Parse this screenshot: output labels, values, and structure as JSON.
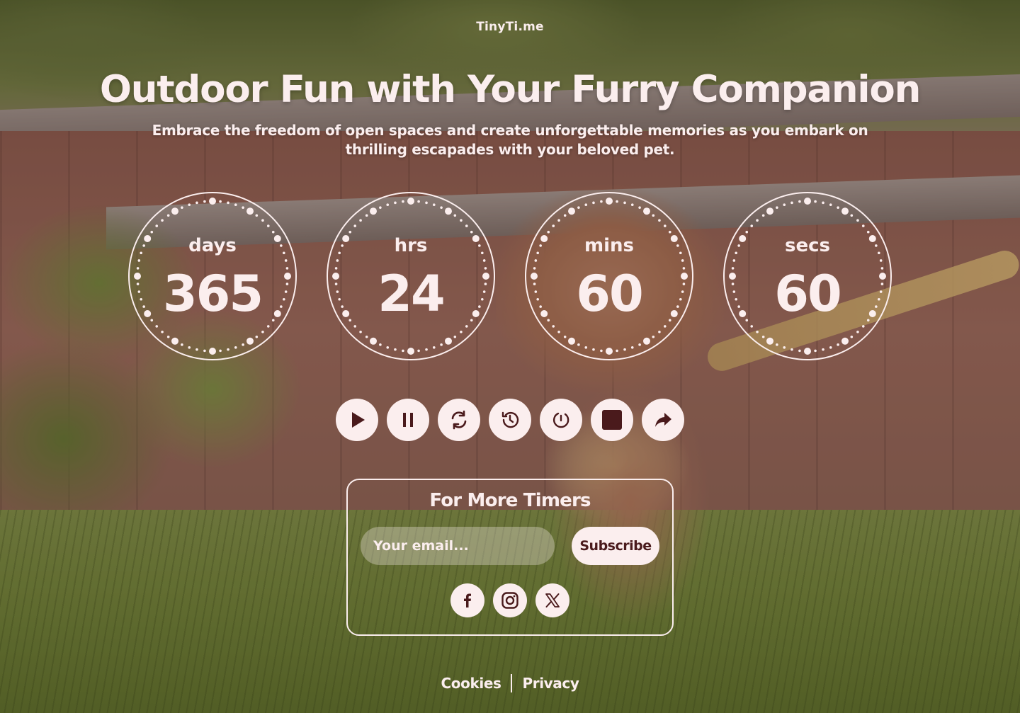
{
  "brand": "TinyTi.me",
  "hero": {
    "title": "Outdoor Fun with Your Furry Companion",
    "subtitle": "Embrace the freedom of open spaces and create unforgettable memories as you embark on thrilling escapades with your beloved pet."
  },
  "timer": [
    {
      "label": "days",
      "value": "365"
    },
    {
      "label": "hrs",
      "value": "24"
    },
    {
      "label": "mins",
      "value": "60"
    },
    {
      "label": "secs",
      "value": "60"
    }
  ],
  "controls": [
    {
      "name": "play",
      "icon": "play-icon"
    },
    {
      "name": "pause",
      "icon": "pause-icon"
    },
    {
      "name": "restart",
      "icon": "refresh-icon"
    },
    {
      "name": "history",
      "icon": "history-icon"
    },
    {
      "name": "reset",
      "icon": "reset-icon"
    },
    {
      "name": "stop",
      "icon": "stop-icon"
    },
    {
      "name": "share",
      "icon": "share-icon"
    }
  ],
  "subscribe": {
    "title": "For More Timers",
    "email_placeholder": "Your email...",
    "button_label": "Subscribe",
    "socials": [
      "facebook-icon",
      "instagram-icon",
      "x-icon"
    ]
  },
  "footer": {
    "cookies": "Cookies",
    "privacy": "Privacy"
  },
  "colors": {
    "text": "#fbeeee",
    "icon_dark": "#4a1a1c",
    "overlay": "#481616"
  }
}
